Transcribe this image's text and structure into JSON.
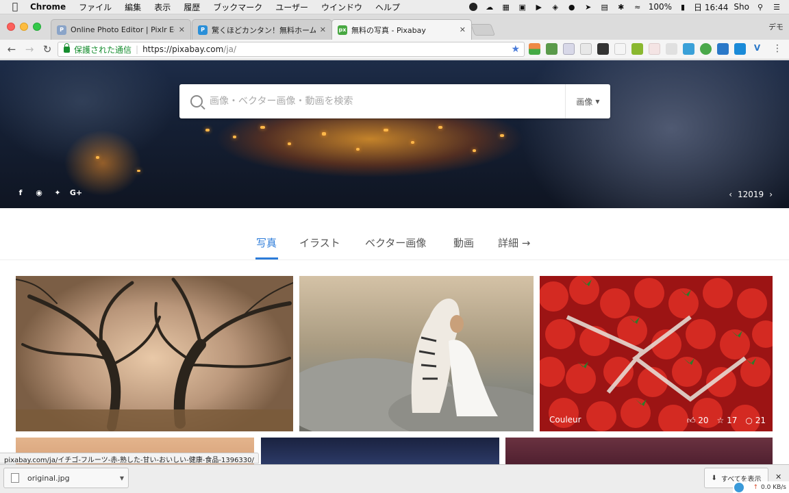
{
  "menubar": {
    "app": "Chrome",
    "items": [
      "ファイル",
      "編集",
      "表示",
      "履歴",
      "ブックマーク",
      "ユーザー",
      "ウインドウ",
      "ヘルプ"
    ],
    "battery": "100%",
    "clock": "日 16:44",
    "user": "Sho"
  },
  "tabs": [
    {
      "title": "Online Photo Editor | Pixlr Edit",
      "fav": "P"
    },
    {
      "title": "驚くほどカンタン！無料ホームペ",
      "fav": "P"
    },
    {
      "title": "無料の写真 - Pixabay",
      "fav": "px"
    }
  ],
  "profile": "デモ",
  "address": {
    "secure_label": "保護された通信",
    "host": "https://pixabay.com",
    "path": "/ja/"
  },
  "hero": {
    "search_placeholder": "画像・ベクター画像・動画を検索",
    "search_type": "画像",
    "counter": "12019"
  },
  "categories": [
    "写真",
    "イラスト",
    "ベクター画像",
    "動画",
    "詳細 →"
  ],
  "photos": [
    {
      "label": "",
      "likes": "",
      "favorites": "",
      "comments": ""
    },
    {
      "label": "",
      "likes": "",
      "favorites": "",
      "comments": ""
    },
    {
      "label": "Couleur",
      "likes": "20",
      "favorites": "17",
      "comments": "21"
    }
  ],
  "status_url": "pixabay.com/ja/イチゴ-フルーツ-赤-熟した-甘い-おいしい-健康-食品-1396330/",
  "download": {
    "filename": "original.jpg",
    "show_all": "すべてを表示"
  },
  "netspeed": "0.0 KB/s"
}
